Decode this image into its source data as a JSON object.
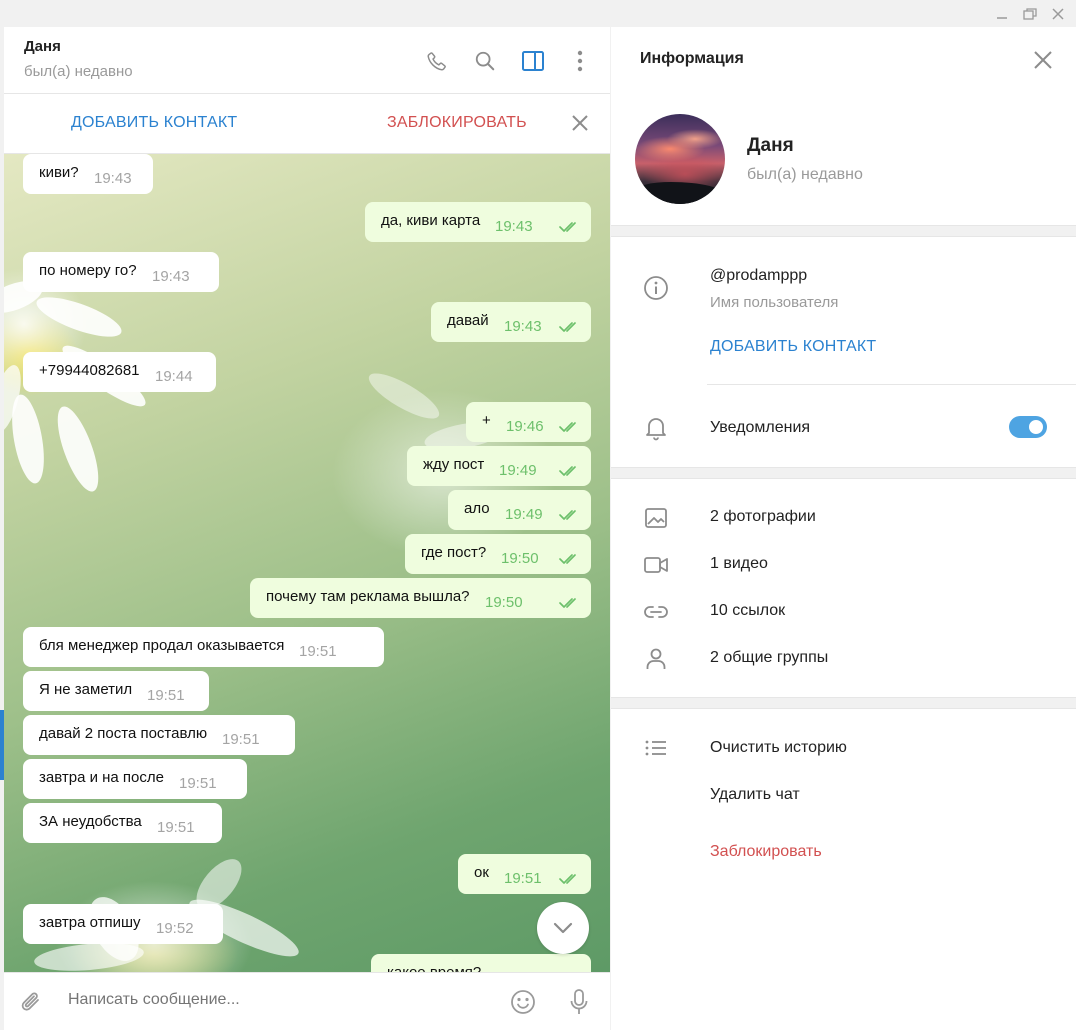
{
  "window": {
    "controls": [
      "minimize",
      "maximize",
      "close"
    ]
  },
  "chat": {
    "name": "Даня",
    "status": "был(а) недавно",
    "header_icons": [
      "phone-icon",
      "search-icon",
      "sidebar-toggle-icon",
      "more-icon"
    ],
    "action_bar": {
      "add_contact": "ДОБАВИТЬ КОНТАКТ",
      "block": "ЗАБЛОКИРОВАТЬ"
    },
    "messages": [
      {
        "dir": "in",
        "text": "киви?",
        "time": "19:43"
      },
      {
        "dir": "out",
        "text": "да, киви карта",
        "time": "19:43",
        "read": true
      },
      {
        "dir": "in",
        "text": "по номеру го?",
        "time": "19:43"
      },
      {
        "dir": "out",
        "text": "давай",
        "time": "19:43",
        "read": true
      },
      {
        "dir": "in",
        "text": "+79944082681",
        "time": "19:44"
      },
      {
        "dir": "out",
        "text": "+",
        "time": "19:46",
        "read": true
      },
      {
        "dir": "out",
        "text": "жду пост",
        "time": "19:49",
        "read": true
      },
      {
        "dir": "out",
        "text": "ало",
        "time": "19:49",
        "read": true
      },
      {
        "dir": "out",
        "text": "где пост?",
        "time": "19:50",
        "read": true
      },
      {
        "dir": "out",
        "text": "почему там реклама вышла?",
        "time": "19:50",
        "read": true
      },
      {
        "dir": "in",
        "text": "бля менеджер продал оказывается",
        "time": "19:51"
      },
      {
        "dir": "in",
        "text": "Я не заметил",
        "time": "19:51"
      },
      {
        "dir": "in",
        "text": "давай 2 поста поставлю",
        "time": "19:51"
      },
      {
        "dir": "in",
        "text": "завтра и на после",
        "time": "19:51"
      },
      {
        "dir": "in",
        "text": "ЗА неудобства",
        "time": "19:51"
      },
      {
        "dir": "out",
        "text": "ок",
        "time": "19:51",
        "read": true
      },
      {
        "dir": "in",
        "text": "завтра отпишу",
        "time": "19:52"
      },
      {
        "dir": "out",
        "text": "какое время?",
        "time": ""
      }
    ],
    "composer": {
      "placeholder": "Написать сообщение..."
    }
  },
  "info": {
    "title": "Информация",
    "profile": {
      "name": "Даня",
      "status": "был(а) недавно"
    },
    "username": {
      "value": "@prodamppp",
      "label": "Имя пользователя",
      "add_contact": "ДОБАВИТЬ КОНТАКТ"
    },
    "notifications": {
      "label": "Уведомления",
      "enabled": true
    },
    "media": [
      {
        "icon": "photo-icon",
        "label": "2 фотографии"
      },
      {
        "icon": "video-icon",
        "label": "1 видео"
      },
      {
        "icon": "link-icon",
        "label": "10 ссылок"
      },
      {
        "icon": "group-icon",
        "label": "2 общие группы"
      }
    ],
    "actions": {
      "clear_history": "Очистить историю",
      "delete_chat": "Удалить чат",
      "block": "Заблокировать"
    }
  },
  "colors": {
    "accent": "#2b82d0",
    "danger": "#d25050",
    "outgoing_bubble": "#effdde",
    "read_ticks": "#6dc06b",
    "toggle": "#4ea4e2"
  }
}
